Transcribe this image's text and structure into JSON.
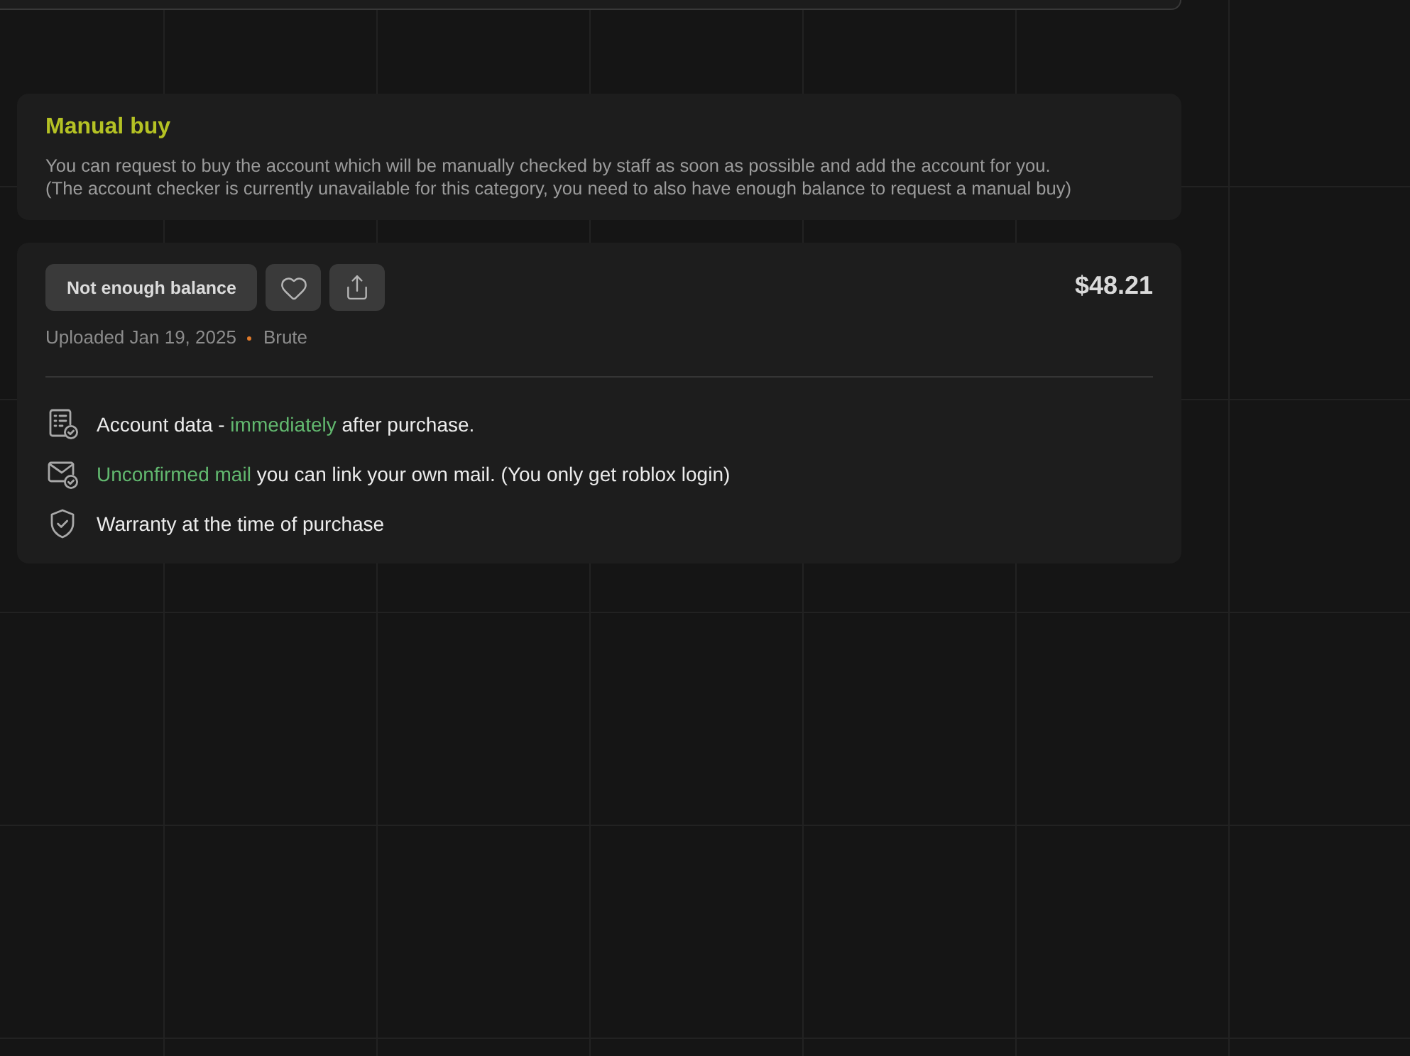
{
  "manual_buy": {
    "title": "Manual buy",
    "description": [
      "You can request to buy the account which will be manually checked by staff as soon as possible and add the account for you.",
      "(The account checker is currently unavailable for this category, you need to also have enough balance to request a manual buy)"
    ]
  },
  "listing": {
    "buy_button": "Not enough balance",
    "price": "$48.21",
    "uploaded": "Uploaded Jan 19, 2025",
    "seller": "Brute",
    "features": [
      {
        "kind": "document",
        "parts": [
          {
            "text": "Account data - ",
            "highlight": false
          },
          {
            "text": "immediately",
            "highlight": true
          },
          {
            "text": " after purchase.",
            "highlight": false
          }
        ]
      },
      {
        "kind": "mail",
        "parts": [
          {
            "text": "Unconfirmed mail",
            "highlight": true
          },
          {
            "text": " you can link your own mail. (You only get roblox login)",
            "highlight": false
          }
        ]
      },
      {
        "kind": "shield",
        "parts": [
          {
            "text": "Warranty at the time of purchase",
            "highlight": false
          }
        ]
      }
    ]
  }
}
